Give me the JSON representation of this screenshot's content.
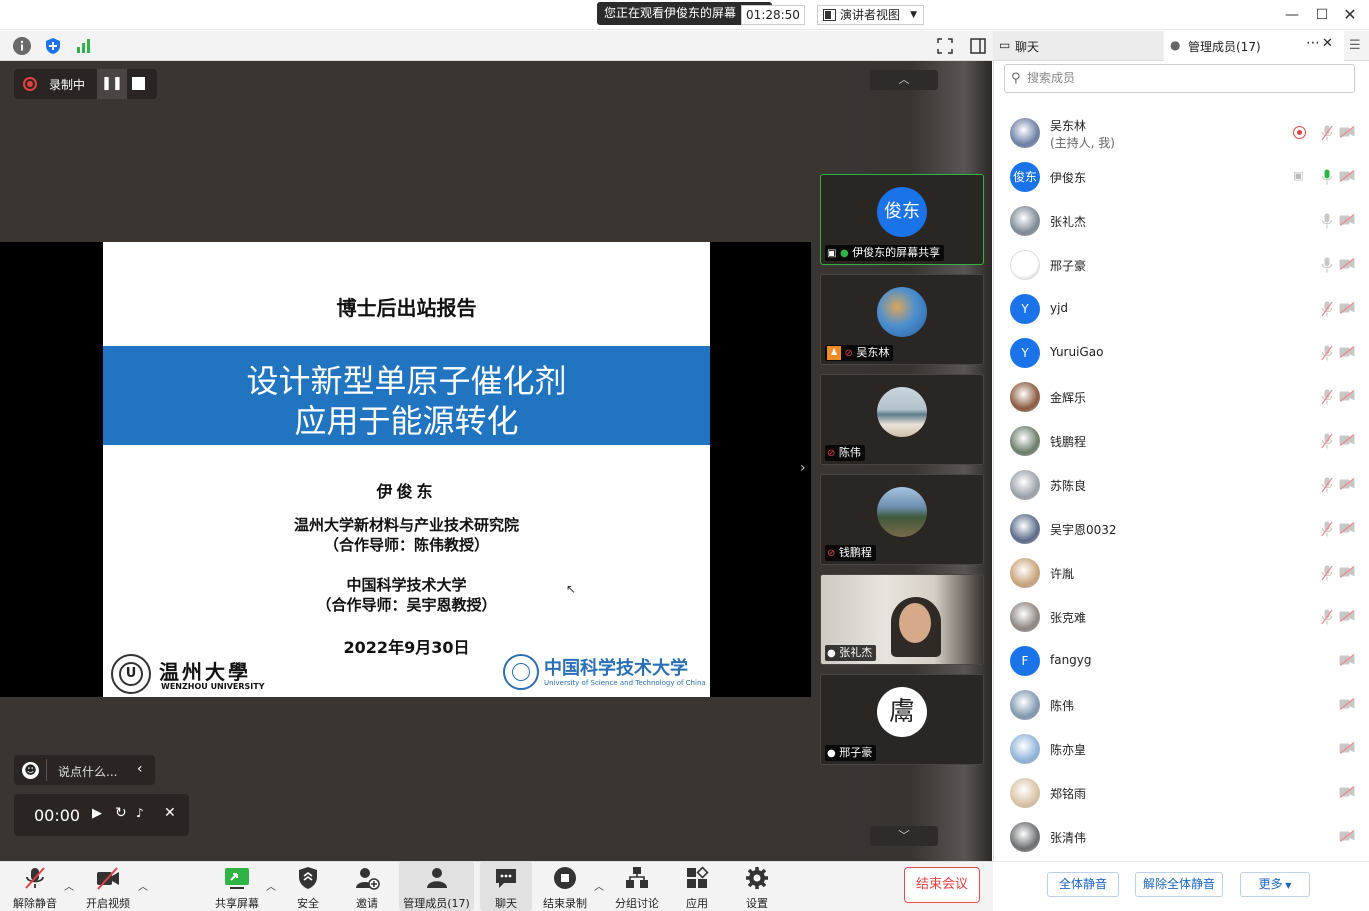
{
  "window": {
    "share_banner": "您正在观看伊俊东的屏幕"
  },
  "toolbar": {
    "timer": "01:28:50",
    "view_mode": "演讲者视图"
  },
  "recording": {
    "label": "录制中"
  },
  "slide": {
    "heading": "博士后出站报告",
    "title_line1": "设计新型单原子催化剂",
    "title_line2": "应用于能源转化",
    "author": "伊俊东",
    "affil1": "温州大学新材料与产业技术研究院",
    "advisor1": "（合作导师：陈伟教授）",
    "affil2": "中国科学技术大学",
    "advisor2": "（合作导师：吴宇恩教授）",
    "date": "2022年9月30日",
    "logo_left_cn": "温州大學",
    "logo_left_en": "WENZHOU UNIVERSITY",
    "logo_right_cn": "中国科学技术大学",
    "logo_right_en": "University of Science and Technology of China"
  },
  "chat_bar": {
    "placeholder": "说点什么..."
  },
  "audio": {
    "time": "00:00"
  },
  "tiles": [
    {
      "initials": "俊东",
      "label": "伊俊东的屏幕共享"
    },
    {
      "label": "吴东林"
    },
    {
      "label": "陈伟"
    },
    {
      "label": "钱鹏程"
    },
    {
      "label": "张礼杰"
    },
    {
      "label": "邢子豪"
    }
  ],
  "panel": {
    "tab_chat": "聊天",
    "tab_members": "管理成员(17)",
    "search_placeholder": "搜索成员",
    "members": [
      {
        "name": "吴东林",
        "sub": "(主持人, 我)",
        "avatar": "photo",
        "color": "#6b7fa6"
      },
      {
        "name": "伊俊东",
        "initials": "俊东",
        "avatar": "initials",
        "color": "#1a73e8"
      },
      {
        "name": "张礼杰",
        "avatar": "photo",
        "color": "#7c8a96"
      },
      {
        "name": "邢子豪",
        "avatar": "photo",
        "color": "#ffffff"
      },
      {
        "name": "yjd",
        "initials": "Y",
        "avatar": "initials",
        "color": "#1a73e8"
      },
      {
        "name": "YuruiGao",
        "initials": "Y",
        "avatar": "initials",
        "color": "#1a73e8"
      },
      {
        "name": "金辉乐",
        "avatar": "photo",
        "color": "#8a5a3c"
      },
      {
        "name": "钱鹏程",
        "avatar": "photo",
        "color": "#6b7d6a"
      },
      {
        "name": "苏陈良",
        "avatar": "photo",
        "color": "#9aa2aa"
      },
      {
        "name": "吴宇恩0032",
        "avatar": "photo",
        "color": "#5a6a8a"
      },
      {
        "name": "许胤",
        "avatar": "photo",
        "color": "#c9a27a"
      },
      {
        "name": "张克难",
        "avatar": "photo",
        "color": "#8d8680"
      },
      {
        "name": "fangyg",
        "initials": "F",
        "avatar": "initials",
        "color": "#1a73e8"
      },
      {
        "name": "陈伟",
        "avatar": "photo",
        "color": "#7f98b0"
      },
      {
        "name": "陈亦皇",
        "avatar": "photo",
        "color": "#8fb3d9"
      },
      {
        "name": "郑铭雨",
        "avatar": "photo",
        "color": "#d9c2a3"
      },
      {
        "name": "张清伟",
        "avatar": "photo",
        "color": "#6d6e70"
      }
    ],
    "btn_mute_all": "全体静音",
    "btn_unmute_all": "解除全体静音",
    "btn_more": "更多"
  },
  "bottom": {
    "unmute": "解除静音",
    "video": "开启视频",
    "share": "共享屏幕",
    "security": "安全",
    "invite": "邀请",
    "members": "管理成员(17)",
    "chat": "聊天",
    "end_record": "结束录制",
    "breakout": "分组讨论",
    "apps": "应用",
    "settings": "设置",
    "end_meeting": "结束会议"
  },
  "colors": {
    "accent": "#1a73e8",
    "danger": "#e34141",
    "slide_band": "#2074c0",
    "stage_bg": "#3b3532"
  }
}
